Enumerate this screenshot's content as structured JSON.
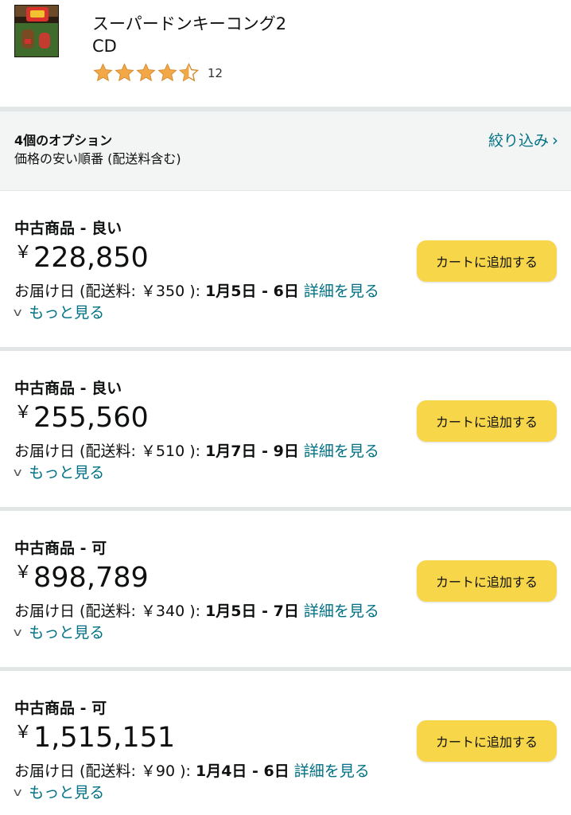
{
  "product": {
    "title": "スーパードンキーコング2",
    "format": "CD",
    "rating_value": 4.5,
    "rating_count": "12"
  },
  "options": {
    "count_label": "4個のオプション",
    "sort_label": "価格の安い順番 (配送料含む)",
    "filter_label": "絞り込み",
    "filter_icon": "chevron-right-icon"
  },
  "offers": [
    {
      "condition": "中古商品 - 良い",
      "currency": "￥",
      "price": "228,850",
      "delivery_prefix": "お届け日 (配送料: ￥350 ): ",
      "delivery_dates": "1月5日 - 6日",
      "details_link": "詳細を見る",
      "more_label": "もっと見る",
      "cart_label": "カートに追加する"
    },
    {
      "condition": "中古商品 - 良い",
      "currency": "￥",
      "price": "255,560",
      "delivery_prefix": "お届け日 (配送料: ￥510 ): ",
      "delivery_dates": "1月7日 - 9日",
      "details_link": "詳細を見る",
      "more_label": "もっと見る",
      "cart_label": "カートに追加する"
    },
    {
      "condition": "中古商品 - 可",
      "currency": "￥",
      "price": "898,789",
      "delivery_prefix": "お届け日 (配送料: ￥340 ): ",
      "delivery_dates": "1月5日 - 7日",
      "details_link": "詳細を見る",
      "more_label": "もっと見る",
      "cart_label": "カートに追加する"
    },
    {
      "condition": "中古商品 - 可",
      "currency": "￥",
      "price": "1,515,151",
      "delivery_prefix": "お届け日 (配送料: ￥90 ): ",
      "delivery_dates": "1月4日 - 6日",
      "details_link": "詳細を見る",
      "more_label": "もっと見る",
      "cart_label": "カートに追加する"
    }
  ],
  "colors": {
    "link": "#007185",
    "star": "#f3a847",
    "cart_button": "#f7d64a",
    "options_bg": "#f3f5f5",
    "divider": "#e3e6e6"
  }
}
